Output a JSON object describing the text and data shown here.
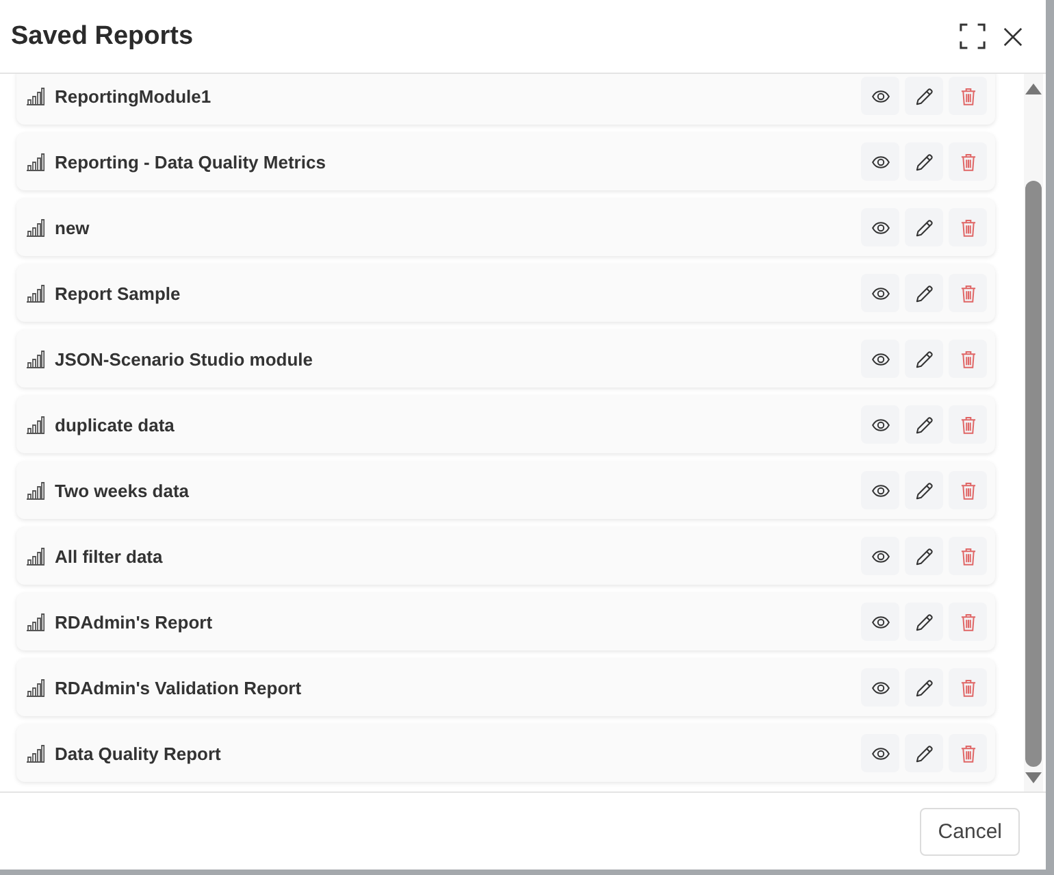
{
  "dialog": {
    "title": "Saved Reports"
  },
  "reports": [
    {
      "name": "ReportingModule1"
    },
    {
      "name": "Reporting - Data Quality Metrics"
    },
    {
      "name": "new"
    },
    {
      "name": "Report Sample"
    },
    {
      "name": "JSON-Scenario Studio module"
    },
    {
      "name": "duplicate data"
    },
    {
      "name": "Two weeks data"
    },
    {
      "name": "All filter data"
    },
    {
      "name": "RDAdmin's Report"
    },
    {
      "name": "RDAdmin's Validation Report"
    },
    {
      "name": "Data Quality Report"
    }
  ],
  "footer": {
    "cancel_button": "Cancel"
  }
}
